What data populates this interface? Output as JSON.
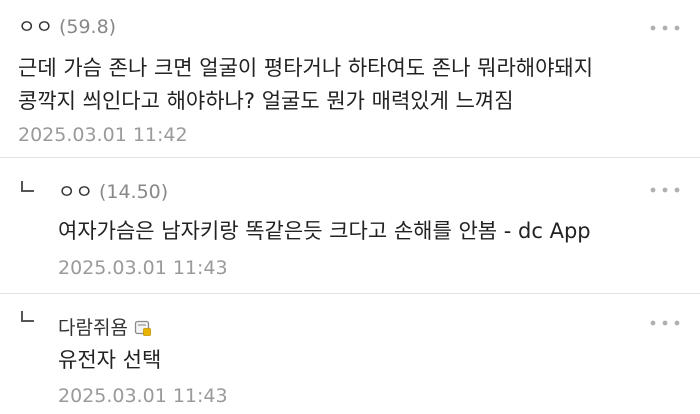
{
  "comments": [
    {
      "author": "ㅇㅇ",
      "score": "(59.8)",
      "text_line1": "근데 가슴 존나 크면 얼굴이 평타거나 하타여도 존나 뭐라해야돼지",
      "text_line2": "콩깍지 씌인다고 해야하나? 얼굴도 뭔가 매력있게 느껴짐",
      "time": "2025.03.01 11:42",
      "more_icon": "more-dots-icon"
    },
    {
      "author": "ㅇㅇ",
      "score": "(14.50)",
      "text": "여자가슴은 남자키랑 똑같은듯 크다고 손해를 안봄 - dc App",
      "time": "2025.03.01 11:43",
      "reply_icon": "reply-arrow-icon",
      "more_icon": "more-dots-icon"
    },
    {
      "author": "다람쥐욤",
      "text": "유전자 선택",
      "time": "2025.03.01 11:43",
      "reply_icon": "reply-arrow-icon",
      "badge_icon": "fixed-nick-badge-icon",
      "more_icon": "more-dots-icon"
    }
  ],
  "colors": {
    "divider": "#e3e3e3",
    "timestamp": "#9a9a9a",
    "score": "#888888",
    "badge": "#e8b400"
  }
}
